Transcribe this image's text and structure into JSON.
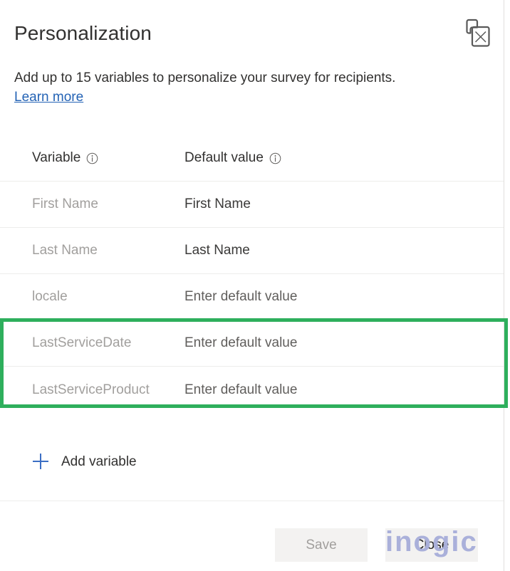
{
  "header": {
    "title": "Personalization",
    "subtitle": "Add up to 15 variables to personalize your survey for recipients.",
    "learn_more_label": "Learn more",
    "close_icon_name": "close-pane-icon"
  },
  "table": {
    "columns": [
      {
        "label": "Variable",
        "info_icon": "info-icon"
      },
      {
        "label": "Default value",
        "info_icon": "info-icon"
      }
    ],
    "rows": [
      {
        "variable": "First Name",
        "variable_is_placeholder": true,
        "default_value": "First Name",
        "default_is_placeholder": false
      },
      {
        "variable": "Last Name",
        "variable_is_placeholder": true,
        "default_value": "Last Name",
        "default_is_placeholder": false
      },
      {
        "variable": "locale",
        "variable_is_placeholder": true,
        "default_value": "Enter default value",
        "default_is_placeholder": true
      },
      {
        "variable": "LastServiceDate",
        "variable_is_placeholder": true,
        "default_value": "Enter default value",
        "default_is_placeholder": true
      },
      {
        "variable": "LastServiceProduct",
        "variable_is_placeholder": true,
        "default_value": "Enter default value",
        "default_is_placeholder": true
      }
    ]
  },
  "highlight": {
    "color": "#2eaf5c",
    "covers_rows": [
      "LastServiceDate",
      "LastServiceProduct"
    ]
  },
  "add_variable": {
    "label": "Add variable",
    "icon": "plus-icon",
    "icon_color": "#3b6ec4"
  },
  "footer": {
    "save_label": "Save",
    "save_disabled": true,
    "close_label": "Close"
  },
  "watermark": {
    "text": "inogic",
    "trademark": "®",
    "color": "#aab0da"
  },
  "colors": {
    "accent_link": "#2463b5",
    "highlight_green": "#2eaf5c",
    "text_primary": "#323130",
    "text_placeholder": "#a19f9d",
    "divider": "#ededeb",
    "button_bg": "#f3f2f1"
  }
}
